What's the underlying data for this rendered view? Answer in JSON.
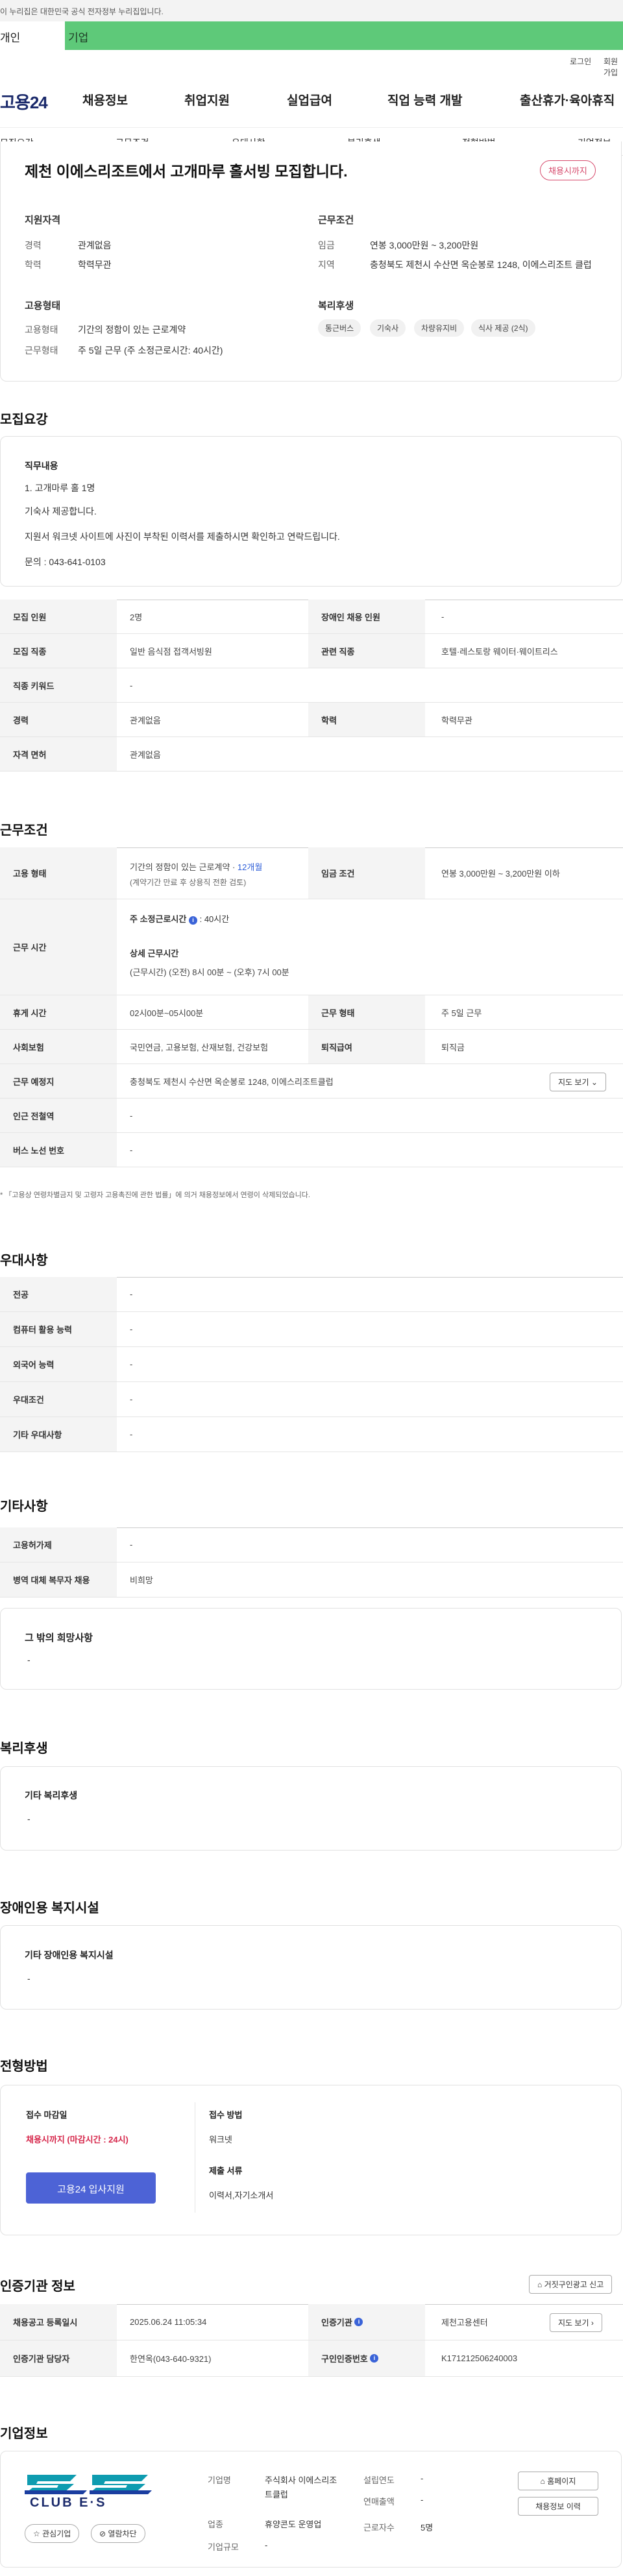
{
  "gov_banner": "이 누리집은 대한민국 공식 전자정부 누리집입니다.",
  "site_tabs": {
    "individual": "개인",
    "company": "기업"
  },
  "top_links": {
    "login": "로그인",
    "signup": "회원가입"
  },
  "logo": "고용24",
  "gnb": [
    "채용정보",
    "취업지원",
    "실업급여",
    "직업 능력 개발",
    "출산휴가·육아휴직"
  ],
  "snb": [
    "모집요강",
    "근무조건",
    "우대사항",
    "복리후생",
    "전형방법",
    "기업정보"
  ],
  "summary": {
    "title": "제천 이에스리조트에서 고개마루 홀서빙 모집합니다.",
    "badge": "채용시까지",
    "qual": {
      "title": "지원자격",
      "rows": [
        [
          "경력",
          "관계없음"
        ],
        [
          "학력",
          "학력무관"
        ]
      ]
    },
    "cond": {
      "title": "근무조건",
      "rows": [
        [
          "임금",
          "연봉 3,000만원 ~ 3,200만원"
        ],
        [
          "지역",
          "충청북도 제천시 수산면 옥순봉로 1248, 이에스리조트 클럽"
        ]
      ]
    },
    "emp": {
      "title": "고용형태",
      "rows": [
        [
          "고용형태",
          "기간의 정함이 있는 근로계약"
        ],
        [
          "근무형태",
          "주 5일 근무 (주 소정근로시간: 40시간)"
        ]
      ]
    },
    "welfare": {
      "title": "복리후생",
      "chips": [
        "통근버스",
        "기숙사",
        "차량유지비",
        "식사 제공 (2식)"
      ]
    }
  },
  "recruit": {
    "section": "모집요강",
    "duty_title": "직무내용",
    "duty_lines": [
      "1. 고개마루 홀 1명",
      "기숙사 제공합니다.",
      "지원서 워크넷 사이트에 사진이 부착된 이력서를 제출하시면 확인하고 연락드립니다.",
      "문의 : 043-641-0103"
    ],
    "table": [
      [
        "모집 인원",
        "2명",
        "장애인 채용 인원",
        "-"
      ],
      [
        "모집 직종",
        "일반 음식점 접객서빙원",
        "관련 직종",
        "호텔·레스토랑 웨이터·웨이트리스"
      ],
      [
        "직종 키워드",
        "-",
        "",
        ""
      ],
      [
        "경력",
        "관계없음",
        "학력",
        "학력무관"
      ],
      [
        "자격 면허",
        "관계없음",
        "",
        ""
      ]
    ]
  },
  "work": {
    "section": "근무조건",
    "emp_type_label": "고용 형태",
    "emp_type_1": "기간의 정함이 있는 근로계약 · ",
    "emp_type_months": "12개월",
    "emp_type_2": "(계약기간 만료 후 상용직 전환 검토)",
    "wage_label": "임금 조건",
    "wage": "연봉 3,000만원 ~ 3,200만원 이하",
    "hours_label": "근무 시간",
    "hours_weekly": "주 소정근로시간",
    "hours_weekly_val": ": 40시간",
    "hours_detail_title": "상세 근무시간",
    "hours_detail": "(근무시간) (오전) 8시 00분 ~ (오후) 7시 00분",
    "rows": [
      [
        "휴게 시간",
        "02시00분~05시00분",
        "근무 형태",
        "주 5일 근무"
      ],
      [
        "사회보험",
        "국민연금, 고용보험, 산재보험, 건강보험",
        "퇴직급여",
        "퇴직금"
      ]
    ],
    "place_label": "근무 예정지",
    "place": "충청북도 제천시 수산면 옥순봉로 1248, 이에스리조트클럽",
    "map_btn": "지도 보기",
    "subway_label": "인근 전철역",
    "subway": "-",
    "bus_label": "버스 노선 번호",
    "bus": "-",
    "note": "* 「고용상 연령차별금지 및 고령자 고용촉진에 관한 법률」에 의거 채용정보에서 연령이 삭제되었습니다."
  },
  "pref": {
    "section": "우대사항",
    "rows": [
      [
        "전공",
        "-"
      ],
      [
        "컴퓨터 활용 능력",
        "-"
      ],
      [
        "외국어 능력",
        "-"
      ],
      [
        "우대조건",
        "-"
      ],
      [
        "기타 우대사항",
        "-"
      ]
    ]
  },
  "etc": {
    "section": "기타사항",
    "rows": [
      [
        "고용허가제",
        "-"
      ],
      [
        "병역 대체 복무자 채용",
        "비희망"
      ]
    ],
    "box_title": "그 밖의 희망사항",
    "box_val": "-"
  },
  "welfare2": {
    "section": "복리후생",
    "box_title": "기타 복리후생",
    "box_val": "-"
  },
  "disab": {
    "section": "장애인용 복지시설",
    "box_title": "기타 장애인용 복지시설",
    "box_val": "-"
  },
  "selection": {
    "section": "전형방법",
    "deadline_title": "접수 마감일",
    "deadline": "채용시까지 (마감시간 : 24시)",
    "apply_btn": "고용24 입사지원",
    "method_title": "접수 방법",
    "method": "워크넷",
    "docs_title": "제출 서류",
    "docs": "이력서,자기소개서"
  },
  "cert": {
    "section": "인증기관 정보",
    "report_btn": "거짓구인광고 신고",
    "reg_label": "채용공고 등록일시",
    "reg": "2025.06.24 11:05:34",
    "org_label": "인증기관",
    "org": "제천고용센터",
    "map_btn": "지도 보기",
    "mgr_label": "인증기관 담당자",
    "mgr": "한연옥(043-640-9321)",
    "auth_label": "구인인증번호",
    "auth": "K171212506240003"
  },
  "company": {
    "section": "기업정보",
    "logo_text": "CLUB E·S",
    "fav_btn": "관심기업",
    "block_btn": "열람차단",
    "name_label": "기업명",
    "name": "주식회사 이에스리조트클럽",
    "ind_label": "업종",
    "ind": "휴양콘도 운영업",
    "scale_label": "기업규모",
    "scale": "-",
    "est_label": "설립연도",
    "est": "-",
    "sales_label": "연매출액",
    "sales": "-",
    "emp_label": "근로자수",
    "emp": "5명",
    "home_btn": "홈페이지",
    "hist_btn": "채용정보 이력"
  }
}
